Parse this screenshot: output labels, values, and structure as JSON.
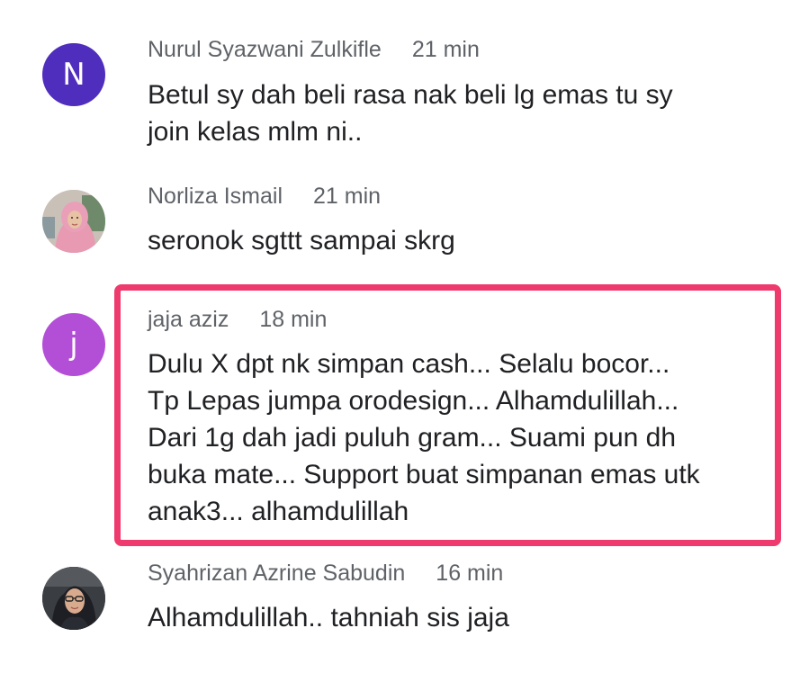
{
  "comments": [
    {
      "avatar_letter": "N",
      "avatar_color": "#4f2dbd",
      "name": "Nurul Syazwani Zulkifle",
      "time": "21 min",
      "lines": [
        "Betul sy dah beli rasa nak beli lg emas tu sy",
        "join kelas mlm ni.."
      ]
    },
    {
      "avatar_icon": "profile-photo-hijab-pink",
      "name": "Norliza Ismail",
      "time": "21 min",
      "lines": [
        "seronok sgttt sampai skrg"
      ]
    },
    {
      "avatar_letter": "j",
      "avatar_color": "#b34fd6",
      "name": "jaja aziz",
      "time": "18 min",
      "highlighted": true,
      "highlight_color": "#ee3a6c",
      "lines": [
        "Dulu X dpt nk simpan cash... Selalu bocor...",
        "Tp Lepas jumpa orodesign... Alhamdulillah...",
        "Dari 1g dah jadi puluh gram... Suami pun dh",
        "buka mate... Support buat simpanan emas utk",
        "anak3... alhamdulillah"
      ]
    },
    {
      "avatar_icon": "profile-photo-hijab-glasses",
      "name": "Syahrizan Azrine Sabudin",
      "time": "16 min",
      "lines": [
        "Alhamdulillah.. tahniah sis jaja"
      ]
    }
  ]
}
